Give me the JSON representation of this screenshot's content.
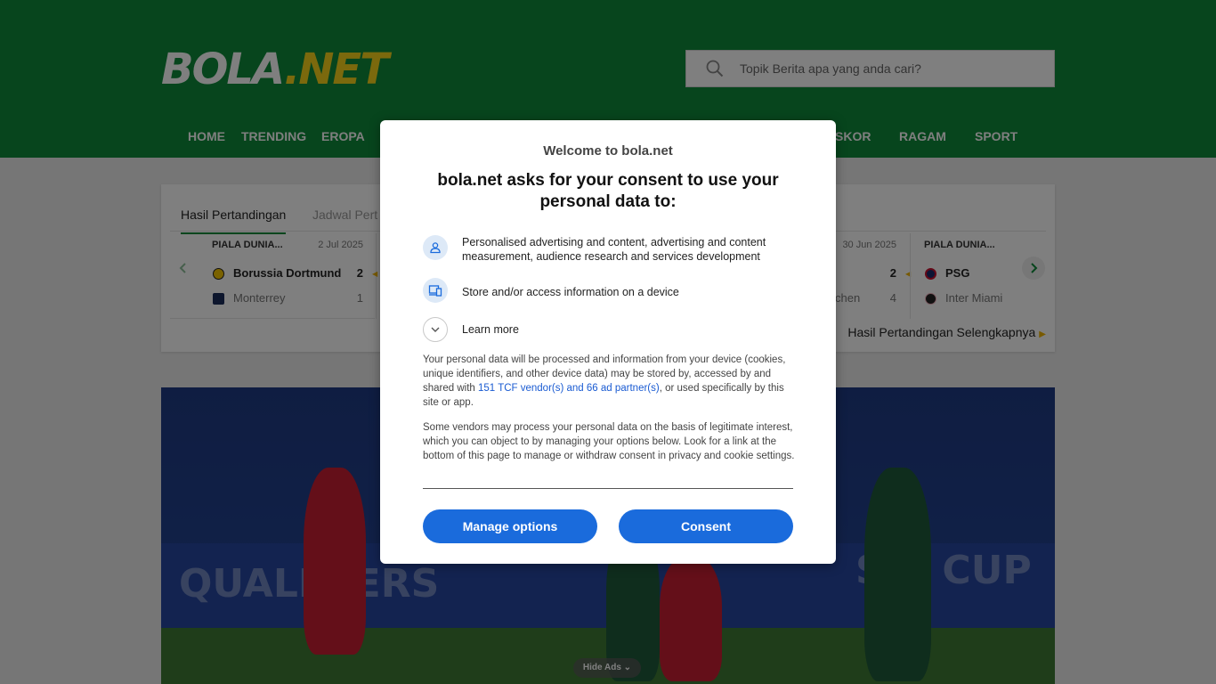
{
  "site": {
    "logo_part1": "BOLA",
    "logo_part2": ".NET",
    "search_placeholder": "Topik Berita apa yang anda cari?"
  },
  "nav": {
    "items": [
      "HOME",
      "TRENDING",
      "EROPA",
      "SKOR",
      "RAGAM",
      "SPORT"
    ]
  },
  "scores": {
    "tabs": [
      "Hasil Pertandingan",
      "Jadwal Pert"
    ],
    "matches": [
      {
        "competition": "PIALA DUNIA...",
        "date": "2 Jul 2025",
        "home": {
          "name": "Borussia Dortmund",
          "score": "2"
        },
        "away": {
          "name": "Monterrey",
          "score": "1"
        }
      },
      {
        "date": "30 Jun 2025",
        "home": {
          "score": "2"
        },
        "away": {
          "name": "chen",
          "score": "4"
        }
      },
      {
        "competition": "PIALA DUNIA...",
        "home": {
          "name": "PSG"
        },
        "away": {
          "name": "Inter Miami"
        }
      }
    ],
    "more_link": "Hasil Pertandingan Selengkapnya"
  },
  "hero": {
    "board_left": "QUALIFIERS",
    "board_right": "SIA CUP"
  },
  "ads": {
    "hide_label": "Hide Ads"
  },
  "consent": {
    "welcome": "Welcome to bola.net",
    "title": "bola.net asks for your consent to use your personal data to:",
    "purposes": [
      {
        "icon": "person-icon",
        "text": "Personalised advertising and content, advertising and content measurement, audience research and services development"
      },
      {
        "icon": "devices-icon",
        "text": "Store and/or access information on a device"
      }
    ],
    "learn_more": "Learn more",
    "para1_before": "Your personal data will be processed and information from your device (cookies, unique identifiers, and other device data) may be stored by, accessed by and shared with ",
    "para1_link": "151 TCF vendor(s) and 66 ad partner(s)",
    "para1_after": ", or used specifically by this site or app.",
    "para2": "Some vendors may process your personal data on the basis of legitimate interest, which you can object to by managing your options below. Look for a link at the bottom of this page to manage or withdraw consent in privacy and cookie settings.",
    "manage_button": "Manage options",
    "consent_button": "Consent"
  },
  "colors": {
    "brand_green": "#0f8a3a",
    "logo_yellow": "#f6d31b",
    "button_blue": "#1a6bdc",
    "link_blue": "#1a5bd2"
  }
}
